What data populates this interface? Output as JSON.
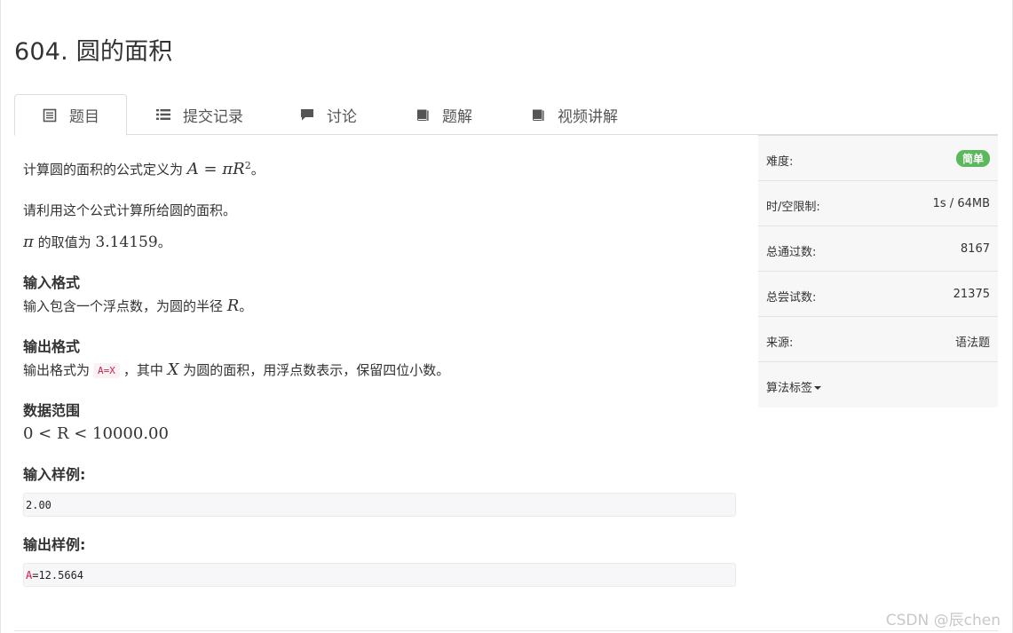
{
  "page": {
    "title": "604. 圆的面积"
  },
  "tabs": [
    {
      "label": "题目",
      "icon": "document-icon",
      "active": true
    },
    {
      "label": "提交记录",
      "icon": "list-icon"
    },
    {
      "label": "讨论",
      "icon": "comment-icon"
    },
    {
      "label": "题解",
      "icon": "book-icon"
    },
    {
      "label": "视频讲解",
      "icon": "book-icon"
    }
  ],
  "problem": {
    "line1_prefix": "计算圆的面积的公式定义为 ",
    "line1_formula": "A = πR",
    "line1_sup": "2",
    "line1_suffix": "。",
    "line2": "请利用这个公式计算所给圆的面积。",
    "line3_pi": "π",
    "line3_mid": " 的取值为 ",
    "line3_value": "3.14159",
    "line3_suffix": "。",
    "input_heading": "输入格式",
    "input_text_prefix": "输入包含一个浮点数，为圆的半径 ",
    "input_var": "R",
    "input_text_suffix": "。",
    "output_heading": "输出格式",
    "output_text_prefix": "输出格式为",
    "output_code": "A=X",
    "output_text_mid": "，其中 ",
    "output_var": "X",
    "output_text_suffix": " 为圆的面积，用浮点数表示，保留四位小数。",
    "range_heading": "数据范围",
    "range_formula": "0 < R < 10000.00",
    "sample_in_heading": "输入样例:",
    "sample_in": "2.00",
    "sample_out_heading": "输出样例:",
    "sample_out_red": "A",
    "sample_out_rest": "=12.5664"
  },
  "sidebar": {
    "difficulty_label": "难度:",
    "difficulty_value": "简单",
    "difficulty_color": "#5cb85c",
    "limit_label": "时/空限制:",
    "limit_value": "1s / 64MB",
    "accepted_label": "总通过数:",
    "accepted_value": "8167",
    "attempts_label": "总尝试数:",
    "attempts_value": "21375",
    "source_label": "来源:",
    "source_value": "语法题",
    "tags_label": "算法标签"
  },
  "watermark": "CSDN @辰chen"
}
